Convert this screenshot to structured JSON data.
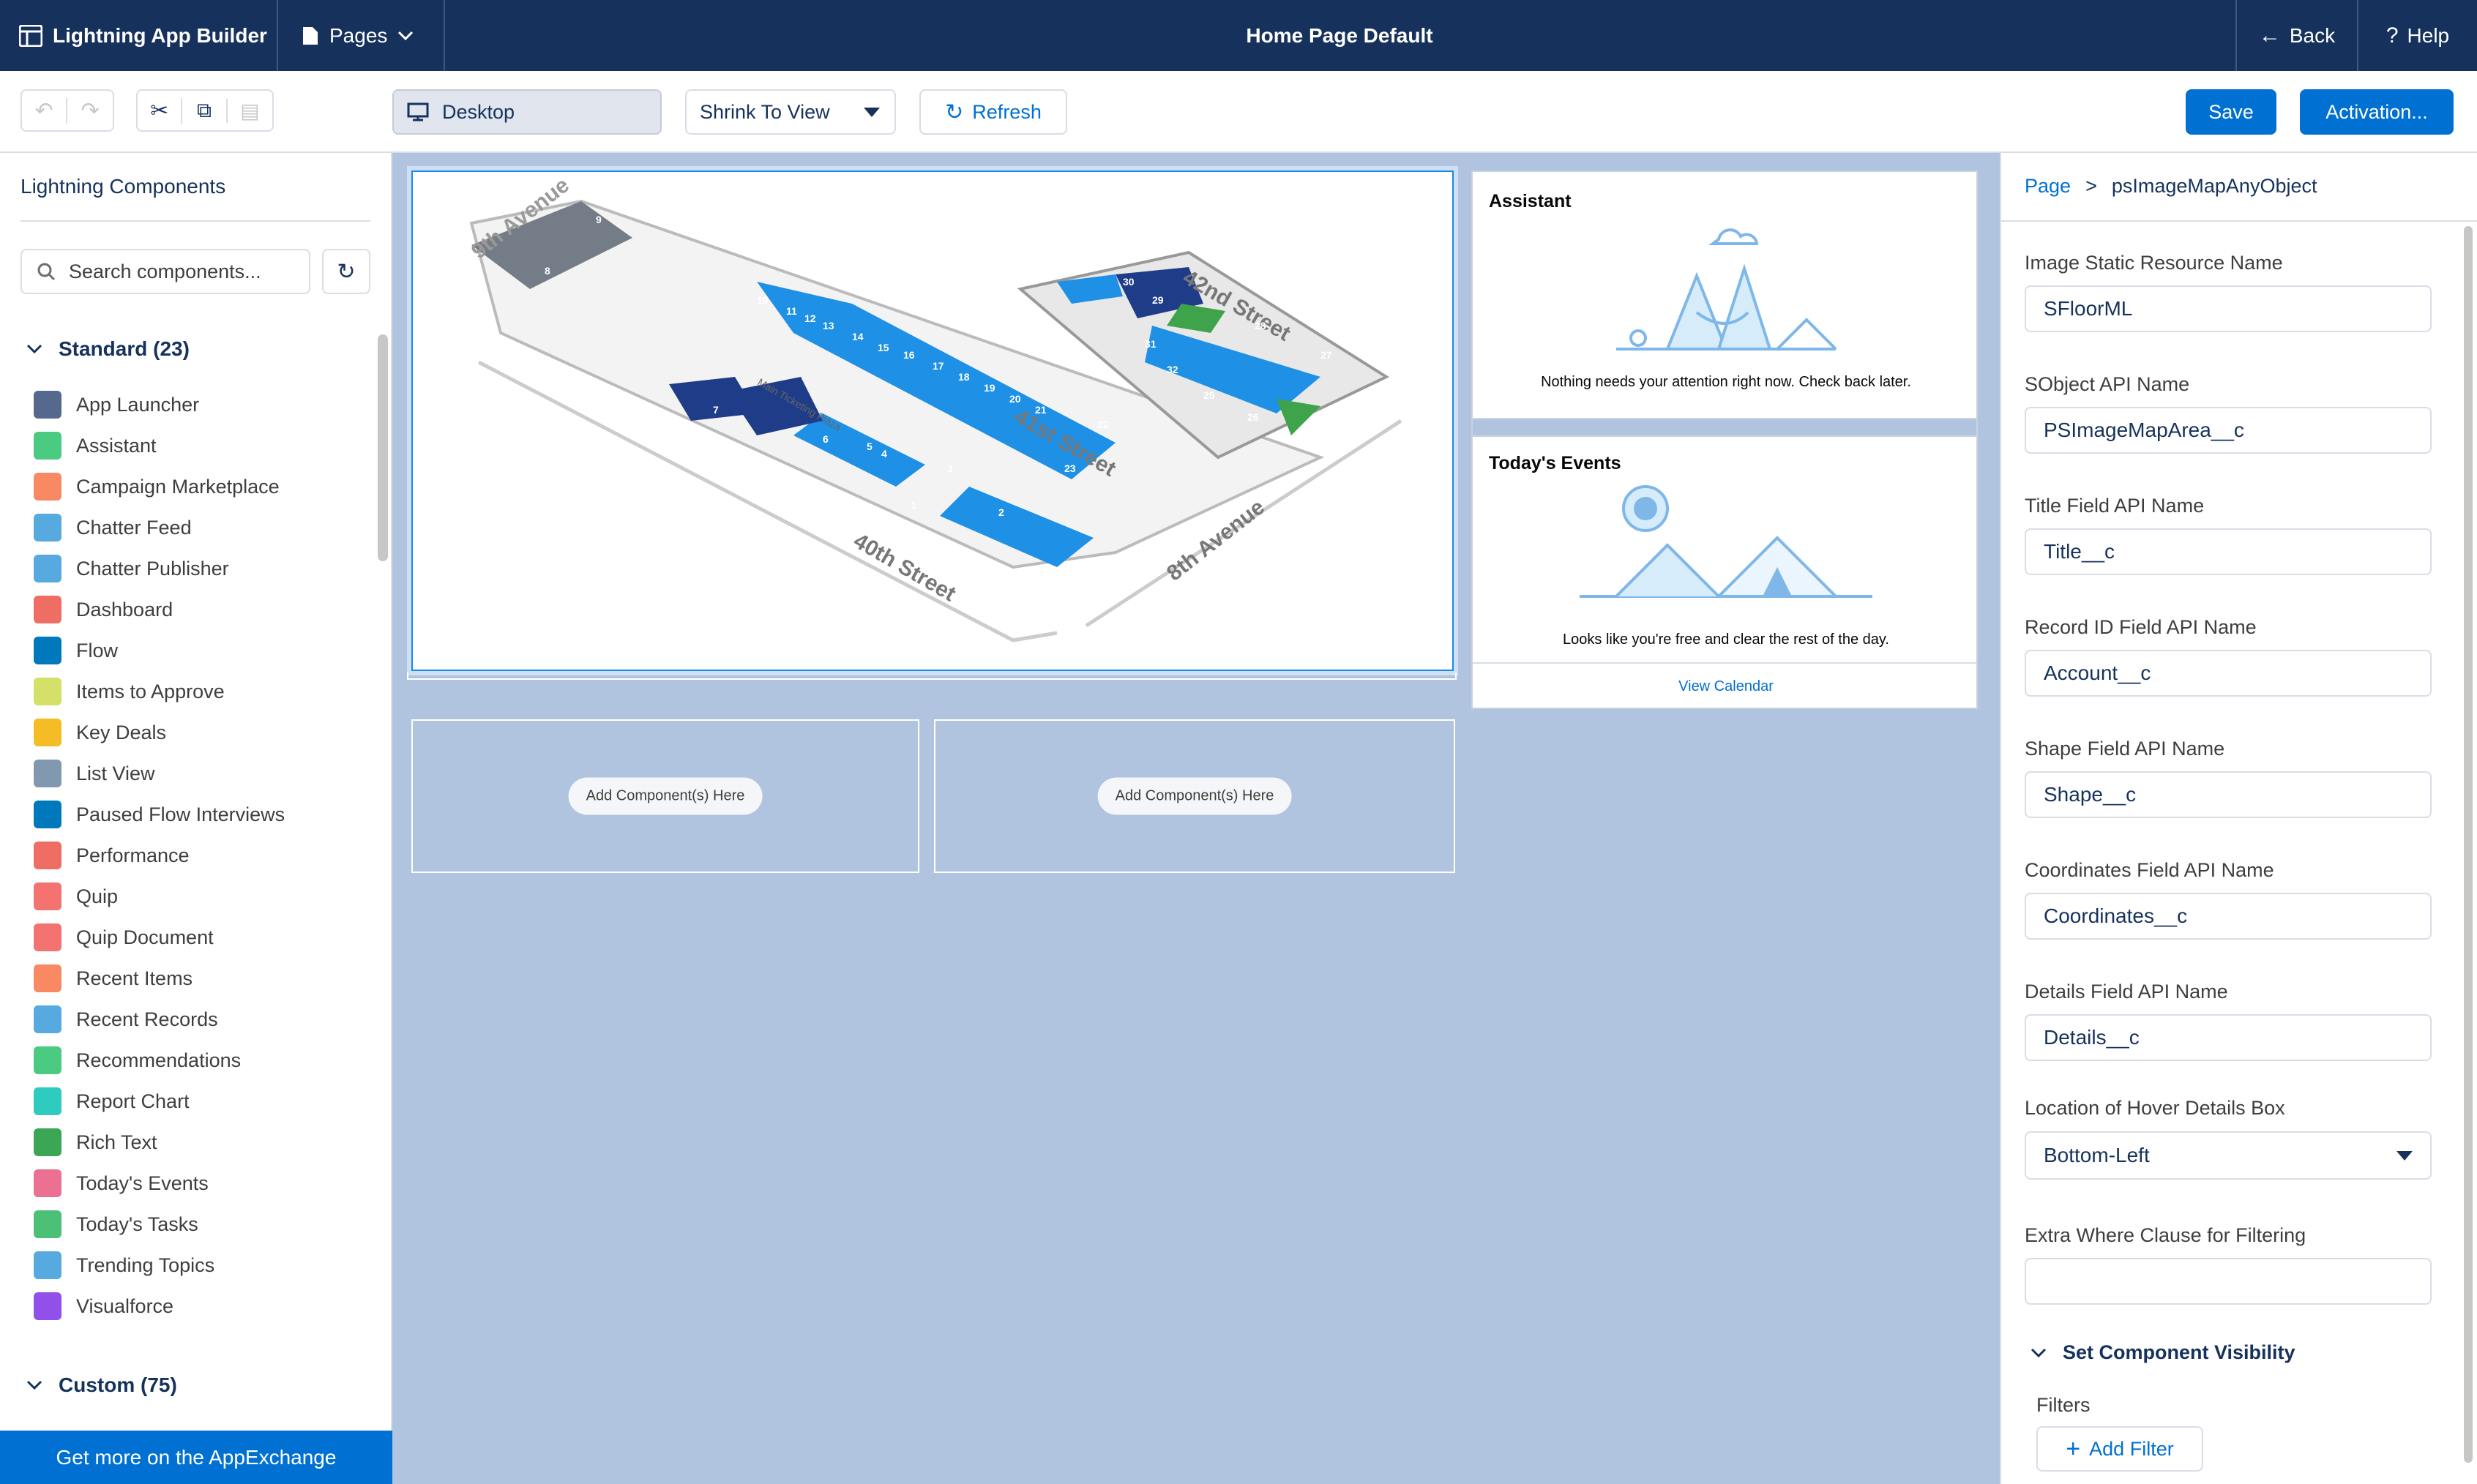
{
  "header": {
    "app_name": "Lightning App Builder",
    "pages_label": "Pages",
    "page_title": "Home Page Default",
    "back_label": "Back",
    "help_label": "Help"
  },
  "toolbar": {
    "device": "Desktop",
    "zoom": "Shrink To View",
    "refresh": "Refresh",
    "save": "Save",
    "activation": "Activation..."
  },
  "left_panel": {
    "title": "Lightning Components",
    "search_placeholder": "Search components...",
    "standard_heading": "Standard (23)",
    "custom_heading": "Custom (75)",
    "appexchange": "Get more on the AppExchange",
    "components": [
      {
        "label": "App Launcher",
        "icon": "grid-icon",
        "color": "#54698d"
      },
      {
        "label": "Assistant",
        "icon": "assistant-icon",
        "color": "#4bca81"
      },
      {
        "label": "Campaign Marketplace",
        "icon": "target-icon",
        "color": "#f88962"
      },
      {
        "label": "Chatter Feed",
        "icon": "chat-icon",
        "color": "#56aadf"
      },
      {
        "label": "Chatter Publisher",
        "icon": "bolt-icon",
        "color": "#56aadf"
      },
      {
        "label": "Dashboard",
        "icon": "gauge-icon",
        "color": "#ef6e64"
      },
      {
        "label": "Flow",
        "icon": "flow-icon",
        "color": "#0079bc"
      },
      {
        "label": "Items to Approve",
        "icon": "approve-icon",
        "color": "#d4e067"
      },
      {
        "label": "Key Deals",
        "icon": "bar-chart-icon",
        "color": "#f4bc25"
      },
      {
        "label": "List View",
        "icon": "list-icon",
        "color": "#8199af"
      },
      {
        "label": "Paused Flow Interviews",
        "icon": "flow-icon",
        "color": "#0079bc"
      },
      {
        "label": "Performance",
        "icon": "chart-icon",
        "color": "#ef6e64"
      },
      {
        "label": "Quip",
        "icon": "quip-icon",
        "color": "#f4726f"
      },
      {
        "label": "Quip Document",
        "icon": "quip-icon",
        "color": "#f4726f"
      },
      {
        "label": "Recent Items",
        "icon": "clock-icon",
        "color": "#f88962"
      },
      {
        "label": "Recent Records",
        "icon": "clock-icon",
        "color": "#56aadf"
      },
      {
        "label": "Recommendations",
        "icon": "bulb-icon",
        "color": "#4bca81"
      },
      {
        "label": "Report Chart",
        "icon": "line-chart-icon",
        "color": "#2ecbbe"
      },
      {
        "label": "Rich Text",
        "icon": "text-icon",
        "color": "#3ba755"
      },
      {
        "label": "Today's Events",
        "icon": "calendar-icon",
        "color": "#eb7092"
      },
      {
        "label": "Today's Tasks",
        "icon": "task-icon",
        "color": "#4bc076"
      },
      {
        "label": "Trending Topics",
        "icon": "topics-icon",
        "color": "#56aadf"
      },
      {
        "label": "Visualforce",
        "icon": "code-icon",
        "color": "#9050e9"
      }
    ]
  },
  "canvas": {
    "assistant_title": "Assistant",
    "assistant_msg": "Nothing needs your attention right now. Check back later.",
    "events_title": "Today's Events",
    "events_msg": "Looks like you're free and clear the rest of the day.",
    "view_calendar": "View Calendar",
    "add_here": "Add Component(s) Here",
    "map": {
      "streets": [
        "9th Avenue",
        "42nd Street",
        "41st Street",
        "40th Street",
        "8th Avenue"
      ],
      "plaza": "Main Ticketing Plaza",
      "units": [
        "1",
        "2",
        "3",
        "4",
        "5",
        "6",
        "7",
        "8",
        "9",
        "10",
        "11",
        "12",
        "13",
        "14",
        "15",
        "16",
        "17",
        "18",
        "19",
        "20",
        "21",
        "22",
        "23",
        "25",
        "26",
        "27",
        "28",
        "29",
        "30",
        "31",
        "32"
      ]
    }
  },
  "right_panel": {
    "breadcrumb_root": "Page",
    "breadcrumb_sep": ">",
    "breadcrumb_current": "psImageMapAnyObject",
    "fields": [
      {
        "label": "Image Static Resource Name",
        "value": "SFloorML"
      },
      {
        "label": "SObject API Name",
        "value": "PSImageMapArea__c"
      },
      {
        "label": "Title Field API Name",
        "value": "Title__c"
      },
      {
        "label": "Record ID Field API Name",
        "value": "Account__c"
      },
      {
        "label": "Shape Field API Name",
        "value": "Shape__c"
      },
      {
        "label": "Coordinates Field API Name",
        "value": "Coordinates__c"
      },
      {
        "label": "Details Field API Name",
        "value": "Details__c"
      }
    ],
    "hover_label": "Location of Hover Details Box",
    "hover_value": "Bottom-Left",
    "extra_label": "Extra Where Clause for Filtering",
    "extra_value": "",
    "visibility": "Set Component Visibility",
    "filters": "Filters",
    "add_filter": "Add Filter"
  }
}
